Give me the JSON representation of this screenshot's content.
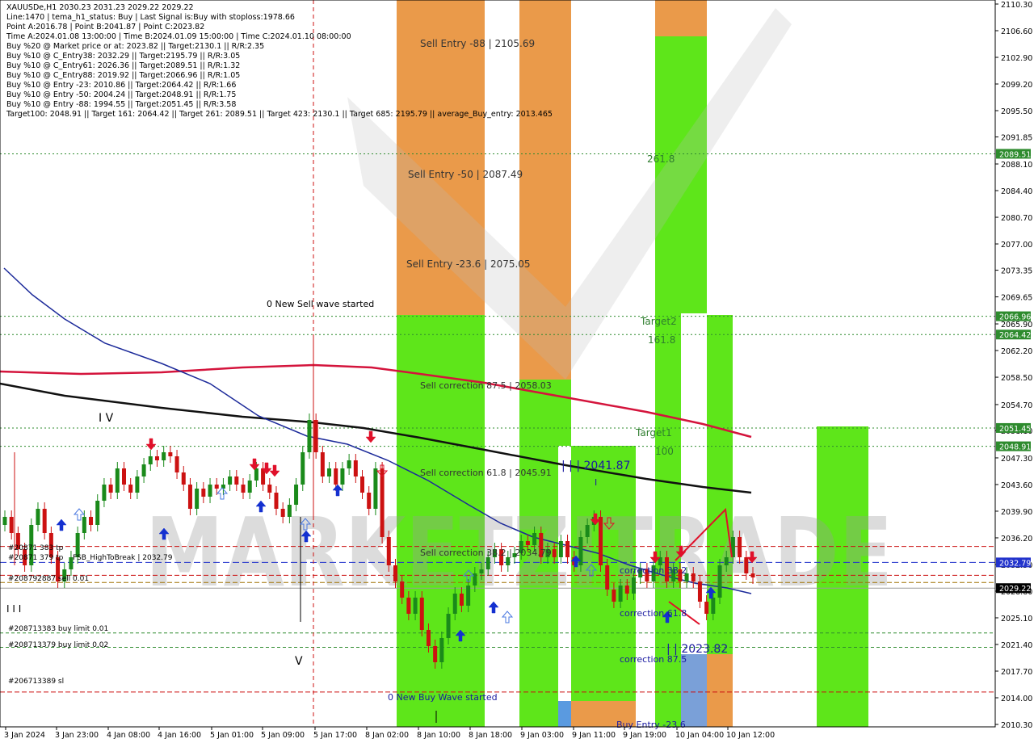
{
  "chart_data": {
    "type": "candlestick",
    "symbol": "XAUUSDe,H1",
    "ohlc_header": "2030.23 2031.23 2029.22 2029.22",
    "info_lines": [
      "XAUUSDe,H1  2030.23 2031.23 2029.22 2029.22",
      "Line:1470  | tema_h1_status: Buy | Last Signal is:Buy with stoploss:1978.66",
      "Point A:2016.78 | Point B:2041.87 | Point C:2023.82",
      "Time A:2024.01.08 13:00:00 | Time B:2024.01.09 15:00:00 | Time C:2024.01.10 08:00:00",
      "Buy %20 @ Market price or at: 2023.82 || Target:2130.1 || R/R:2.35",
      "Buy %10 @ C_Entry38: 2032.29 || Target:2195.79 || R/R:3.05",
      "Buy %10 @ C_Entry61: 2026.36 || Target:2089.51 || R/R:1.32",
      "Buy %10 @ C_Entry88: 2019.92 || Target:2066.96 || R/R:1.05",
      "Buy %10 @ Entry -23: 2010.86 || Target:2064.42 || R/R:1.66",
      "Buy %10 @ Entry -50: 2004.24 || Target:2048.91 || R/R:1.75",
      "Buy %10 @ Entry -88: 1994.55 || Target:2051.45 || R/R:3.58",
      "Target100: 2048.91 || Target 161: 2064.42 || Target 261: 2089.51 || Target 423: 2130.1 || Target 685: 2195.79 || average_Buy_entry: 2013.465"
    ],
    "y_ticks": [
      "2110.30",
      "2106.60",
      "2102.90",
      "2099.20",
      "2095.50",
      "2091.85",
      "2088.10",
      "2084.40",
      "2080.70",
      "2077.00",
      "2073.35",
      "2069.65",
      "2065.90",
      "2062.20",
      "2058.50",
      "2054.70",
      "2051.10",
      "2047.30",
      "2043.60",
      "2039.90",
      "2036.20",
      "2032.50",
      "2028.80",
      "2025.10",
      "2021.40",
      "2017.70",
      "2014.00",
      "2010.30"
    ],
    "x_ticks": [
      "3 Jan 2024",
      "3 Jan 23:00",
      "4 Jan 08:00",
      "4 Jan 16:00",
      "5 Jan 01:00",
      "5 Jan 09:00",
      "5 Jan 17:00",
      "8 Jan 02:00",
      "8 Jan 10:00",
      "8 Jan 18:00",
      "9 Jan 03:00",
      "9 Jan 11:00",
      "9 Jan 19:00",
      "10 Jan 04:00",
      "10 Jan 12:00"
    ],
    "ylim": [
      2010.3,
      2110.3
    ],
    "price_tags": [
      {
        "price": 2089.51,
        "text": "2089.51",
        "color": "#2e8b2e"
      },
      {
        "price": 2066.96,
        "text": "2066.96",
        "color": "#2e8b2e"
      },
      {
        "price": 2064.42,
        "text": "2064.42",
        "color": "#2e8b2e"
      },
      {
        "price": 2051.45,
        "text": "2051.45",
        "color": "#2e8b2e"
      },
      {
        "price": 2048.91,
        "text": "2048.91",
        "color": "#2e8b2e"
      },
      {
        "price": 2032.79,
        "text": "2032.79",
        "color": "#2233cc"
      },
      {
        "price": 2029.22,
        "text": "2029.22",
        "color": "#000000"
      }
    ],
    "annotations": [
      {
        "text": "Sell Entry -88 | 2105.69",
        "color": "#333333"
      },
      {
        "text": "Sell Entry -50 | 2087.49",
        "color": "#333333"
      },
      {
        "text": "Sell Entry -23.6 | 2075.05",
        "color": "#333333"
      },
      {
        "text": "0 New Sell wave started",
        "color": "#000000"
      },
      {
        "text": "Sell correction 87.5 | 2058.03",
        "color": "#333333"
      },
      {
        "text": "Sell correction 61.8 | 2045.91",
        "color": "#333333"
      },
      {
        "text": "Sell correction 38.2 | 2034.79",
        "color": "#333333"
      },
      {
        "text": "0 New Buy Wave started",
        "color": "#1a1aa0"
      },
      {
        "text": "261.8",
        "color": "#2e7d2e"
      },
      {
        "text": "Target2",
        "color": "#2e7d2e"
      },
      {
        "text": "161.8",
        "color": "#2e7d2e"
      },
      {
        "text": "Target1",
        "color": "#2e7d2e"
      },
      {
        "text": "100",
        "color": "#2e7d2e"
      },
      {
        "text": "| | | 2041.87",
        "color": "#1a1aa0"
      },
      {
        "text": "correction 38.2",
        "color": "#1a1aa0"
      },
      {
        "text": "correction 61.8",
        "color": "#1a1aa0"
      },
      {
        "text": "correction 87.5",
        "color": "#1a1aa0"
      },
      {
        "text": "| | 2023.82",
        "color": "#1a1aa0"
      },
      {
        "text": "Buy Entry -23.6",
        "color": "#1a1aa0"
      },
      {
        "text": "I V",
        "color": "#000000"
      },
      {
        "text": "V",
        "color": "#000000"
      },
      {
        "text": "I I I",
        "color": "#000000"
      },
      {
        "text": "I",
        "color": "#1a1aa0"
      }
    ],
    "left_labels": [
      "#20871 383 tp",
      "#20871 379 tp",
      "#208792887 sell 0.01",
      "#208713383 buy limit 0.01",
      "#208713379 buy limit 0.02",
      "#206713389 sl"
    ],
    "fsb_label": "FSB_HighToBreak | 2032.79",
    "watermark": "MARKETZITRADE",
    "colors": {
      "red_ma": "#d4143c",
      "black_ma": "#111111",
      "blue_ma": "#1c2a9a",
      "bull": "#1a8a1a",
      "bear": "#cc1111",
      "green_zone": "#5ee61a",
      "orange_zone": "#ea9a4a"
    }
  }
}
